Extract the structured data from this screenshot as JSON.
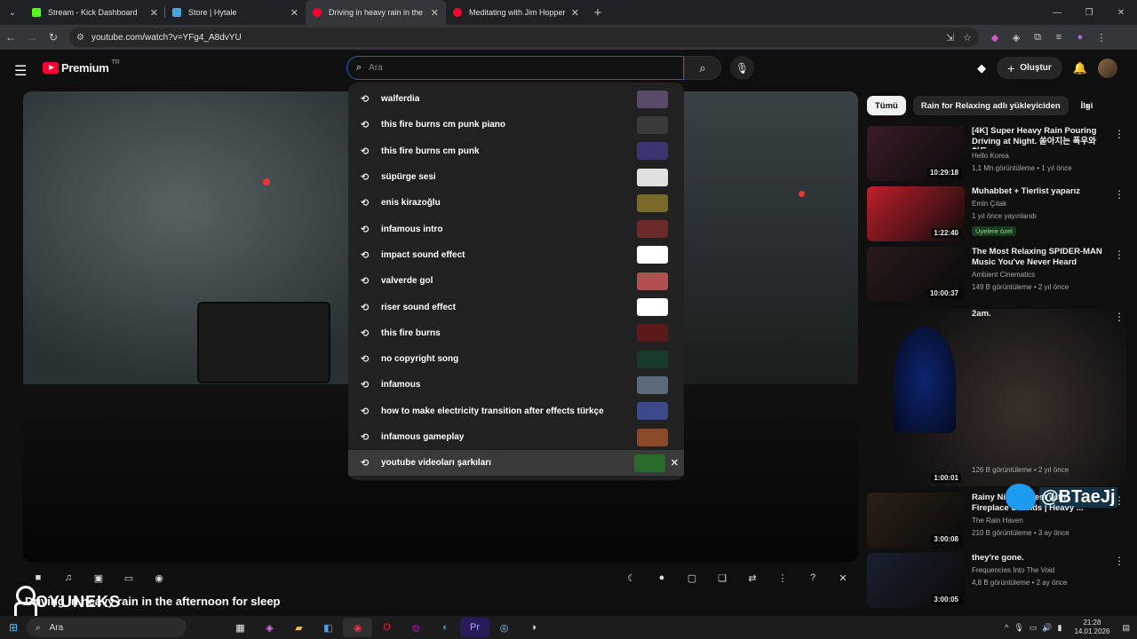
{
  "browser": {
    "tabs": [
      {
        "title": "Stream - Kick Dashboard",
        "color": "#53fc18",
        "active": false
      },
      {
        "title": "Store | Hytale",
        "color": "#4aa3df",
        "active": false
      },
      {
        "title": "Driving in heavy rain in the afte",
        "color": "#ff0033",
        "active": true
      },
      {
        "title": "Meditating with Jim Hopper in",
        "color": "#ff0033",
        "active": false
      }
    ],
    "url": "youtube.com/watch?v=YFg4_A8dvYU"
  },
  "youtube": {
    "logo_word": "Premium",
    "country_code": "TR",
    "search_placeholder": "Ara",
    "create_label": "Oluştur"
  },
  "suggestions": [
    {
      "text": "walferdia",
      "thumb": "#5a4a6a"
    },
    {
      "text": "this fire burns cm punk piano",
      "thumb": "#3a3a3a"
    },
    {
      "text": "this fire burns cm punk",
      "thumb": "#3a3470"
    },
    {
      "text": "süpürge sesi",
      "thumb": "#e0e0e0"
    },
    {
      "text": "enis kirazoğlu",
      "thumb": "#7a6a2a"
    },
    {
      "text": "infamous intro",
      "thumb": "#6a2a2a"
    },
    {
      "text": "impact sound effect",
      "thumb": "#ffffff"
    },
    {
      "text": "valverde gol",
      "thumb": "#b05050"
    },
    {
      "text": "riser sound effect",
      "thumb": "#ffffff"
    },
    {
      "text": "this fire burns",
      "thumb": "#5a1a1a"
    },
    {
      "text": "no copyright song",
      "thumb": "#1a3a2a"
    },
    {
      "text": "infamous",
      "thumb": "#5a6a7a"
    },
    {
      "text": "how to make electricity transition after effects türkçe",
      "thumb": "#3a4a8a"
    },
    {
      "text": "infamous gameplay",
      "thumb": "#8a4a2a"
    },
    {
      "text": "youtube videoları şarkıları",
      "thumb": "#2a6a2a"
    }
  ],
  "player": {
    "title": "Driving in heavy rain in the afternoon for sleep",
    "overlay_logo": "OYUNEKS"
  },
  "chips": [
    "Tümü",
    "Rain for Relaxing adlı yükleyiciden",
    "İlgi"
  ],
  "recommendations": [
    {
      "title": "[4K] Super Heavy Rain Pouring Driving at Night. 쏟아지는 폭우와 천둥 ...",
      "channel": "Hello Korea",
      "views": "1,1 Mn görüntüleme • 1 yıl önce",
      "duration": "10:29:18",
      "thumb": "#3a1a2a"
    },
    {
      "title": "Muhabbet + Tierlist yaparız",
      "channel": "Emin Çıtak",
      "views": "1 yıl önce yayınlandı",
      "badge": "Üyelere özel",
      "duration": "1:22:40",
      "thumb": "#c0202a"
    },
    {
      "title": "The Most Relaxing SPIDER-MAN Music You've Never Heard",
      "channel": "Ambient Cinematics",
      "views": "149 B görüntüleme • 2 yıl önce",
      "duration": "10:00:37",
      "thumb": "#2a1a1a"
    },
    {
      "title": "2am.",
      "channel": "",
      "views": "126 B görüntüleme • 2 yıl önce",
      "duration": "1:00:01",
      "thumb": "#1a2a3a"
    },
    {
      "title": "Rainy Night Forest with Fireplace Sounds | Heavy ...",
      "channel": "The Rain Haven",
      "views": "210 B görüntüleme • 3 ay önce",
      "duration": "3:00:08",
      "thumb": "#2a2016"
    },
    {
      "title": "they're gone.",
      "channel": "Frequencies Into The Void",
      "views": "4,8 B görüntüleme • 2 ay önce",
      "duration": "3:00:05",
      "thumb": "#1a2030"
    }
  ],
  "overlay": {
    "twitter_handle": "@BTaeJj"
  },
  "taskbar": {
    "search": "Ara",
    "time": "21:28",
    "date": "14.01.2026"
  }
}
